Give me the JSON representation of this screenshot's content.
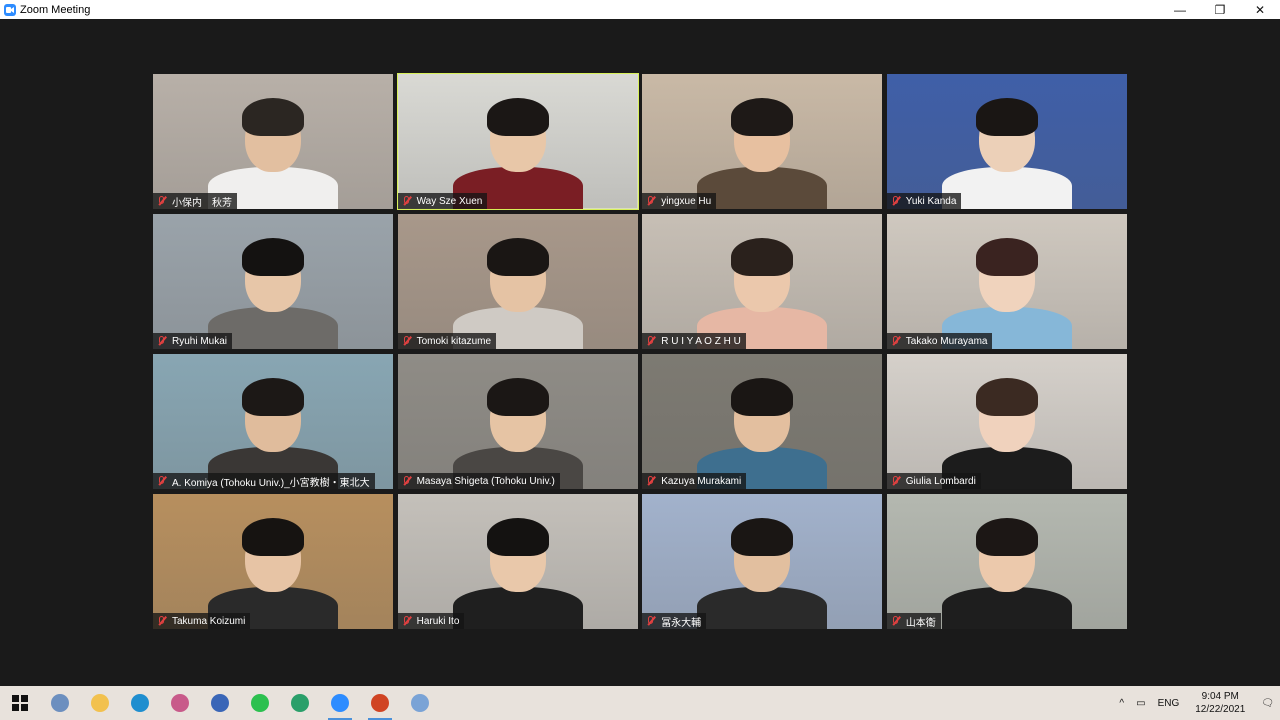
{
  "window": {
    "title": "Zoom Meeting",
    "minimize": "—",
    "restore": "❐",
    "close": "✕"
  },
  "participants": [
    {
      "name": "小保内　秋芳",
      "bg": "#b8b0a8",
      "skin": "#e2bfa0",
      "hair": "#2b2622",
      "shirt": "#f0efee"
    },
    {
      "name": "Way Sze Xuen",
      "bg": "#d9d9d4",
      "skin": "#e8c7a8",
      "hair": "#1b1715",
      "shirt": "#7a1e24",
      "active": true
    },
    {
      "name": "yingxue Hu",
      "bg": "#c9b9a6",
      "skin": "#e7c0a0",
      "hair": "#1e1917",
      "shirt": "#5b4a3a"
    },
    {
      "name": "Yuki Kanda",
      "bg": "#3f5fa8",
      "skin": "#ecd0b8",
      "hair": "#1a1614",
      "shirt": "#f2f2f2"
    },
    {
      "name": "Ryuhi Mukai",
      "bg": "#9aa3aa",
      "skin": "#e7c6a8",
      "hair": "#141211",
      "shirt": "#6d6b68"
    },
    {
      "name": "Tomoki kitazume",
      "bg": "#a8988a",
      "skin": "#e5c3a4",
      "hair": "#1a1614",
      "shirt": "#cfcac4"
    },
    {
      "name": "R U I Y A O  Z H U",
      "bg": "#c7bfb5",
      "skin": "#ebc8ac",
      "hair": "#2a211c",
      "shirt": "#e6b7a4"
    },
    {
      "name": "Takako Murayama",
      "bg": "#cfc8bf",
      "skin": "#f0d3bd",
      "hair": "#3a2320",
      "shirt": "#86b7d8"
    },
    {
      "name": "A. Komiya (Tohoku Univ.)_小宮教樹・東北大",
      "bg": "#88a6b3",
      "skin": "#e0bc9c",
      "hair": "#1c1816",
      "shirt": "#3a3735"
    },
    {
      "name": "Masaya Shigeta (Tohoku Univ.)",
      "bg": "#8f8c86",
      "skin": "#e6c4a4",
      "hair": "#1b1715",
      "shirt": "#4a4744"
    },
    {
      "name": "Kazuya Murakami",
      "bg": "#7d7a72",
      "skin": "#e3bf9f",
      "hair": "#1a1614",
      "shirt": "#3e6f8f"
    },
    {
      "name": "Giulia Lombardi",
      "bg": "#d5d0ca",
      "skin": "#f0d2bd",
      "hair": "#3b2a22",
      "shirt": "#1c1c1c"
    },
    {
      "name": "Takuma Koizumi",
      "bg": "#b78f5e",
      "skin": "#e7c4a5",
      "hair": "#161311",
      "shirt": "#2a2a2a"
    },
    {
      "name": "Haruki Ito",
      "bg": "#c4c0ba",
      "skin": "#e9c8aa",
      "hair": "#141211",
      "shirt": "#1f1f1f"
    },
    {
      "name": "冨永大輔",
      "bg": "#a2b2cc",
      "skin": "#e2bf9f",
      "hair": "#1a1614",
      "shirt": "#2a2a2a"
    },
    {
      "name": "山本衛",
      "bg": "#b4b8b0",
      "skin": "#ecc9ac",
      "hair": "#1c1715",
      "shirt": "#1e1e1e"
    }
  ],
  "taskbar": {
    "items": [
      {
        "icon": "windows-start-icon",
        "color": "#1a1a1a",
        "open": false
      },
      {
        "icon": "network-icon",
        "color": "#6c8fbf",
        "open": false
      },
      {
        "icon": "file-explorer-icon",
        "color": "#f2c14e",
        "open": false
      },
      {
        "icon": "edge-icon",
        "color": "#1f8ecf",
        "open": false
      },
      {
        "icon": "app-icon",
        "color": "#c85a8a",
        "open": false
      },
      {
        "icon": "app-icon-2",
        "color": "#3a66b7",
        "open": false
      },
      {
        "icon": "line-icon",
        "color": "#2cc04f",
        "open": false
      },
      {
        "icon": "edge-icon-2",
        "color": "#2a9f6a",
        "open": false
      },
      {
        "icon": "zoom-icon",
        "color": "#2d8cff",
        "open": true
      },
      {
        "icon": "powerpoint-icon",
        "color": "#d04423",
        "open": true
      },
      {
        "icon": "paint-icon",
        "color": "#7aa3d6",
        "open": false
      }
    ],
    "tray": {
      "chevron": "^",
      "lang": "ENG",
      "time": "9:04 PM",
      "date": "12/22/2021"
    }
  }
}
